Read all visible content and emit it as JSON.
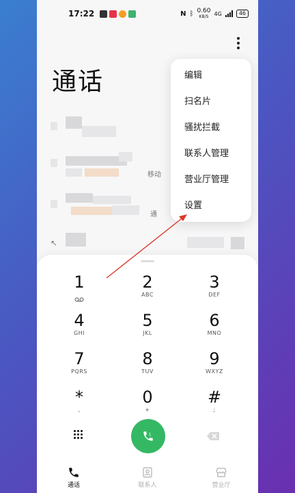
{
  "status": {
    "time": "17:22",
    "network_speed": "0.60",
    "network_unit": "KB/S",
    "network_type": "4G",
    "battery": "46"
  },
  "page": {
    "title": "通话"
  },
  "menu": {
    "items": [
      {
        "label": "编辑"
      },
      {
        "label": "扫名片"
      },
      {
        "label": "骚扰拦截"
      },
      {
        "label": "联系人管理"
      },
      {
        "label": "营业厅管理"
      },
      {
        "label": "设置"
      }
    ]
  },
  "call_log": {
    "tags": [
      "移动",
      "通"
    ]
  },
  "dialpad": {
    "keys": [
      {
        "digit": "1",
        "letters": ""
      },
      {
        "digit": "2",
        "letters": "ABC"
      },
      {
        "digit": "3",
        "letters": "DEF"
      },
      {
        "digit": "4",
        "letters": "GHI"
      },
      {
        "digit": "5",
        "letters": "JKL"
      },
      {
        "digit": "6",
        "letters": "MNO"
      },
      {
        "digit": "7",
        "letters": "PQRS"
      },
      {
        "digit": "8",
        "letters": "TUV"
      },
      {
        "digit": "9",
        "letters": "WXYZ"
      },
      {
        "digit": "*",
        "letters": ","
      },
      {
        "digit": "0",
        "letters": "+"
      },
      {
        "digit": "#",
        "letters": ";"
      }
    ]
  },
  "nav": {
    "items": [
      {
        "label": "通话"
      },
      {
        "label": "联系人"
      },
      {
        "label": "营业厅"
      }
    ]
  },
  "colors": {
    "accent_call": "#34b864",
    "annotation": "#d93a2b"
  }
}
